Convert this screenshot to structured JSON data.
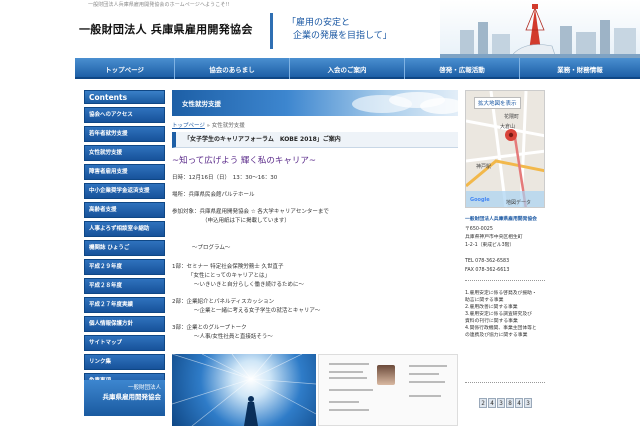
{
  "header": {
    "tagline": "一般財団法人兵庫県雇用開発協会のホームページへようこそ!!",
    "org_name": "一般財団法人 兵庫県雇用開発協会",
    "slogan_line1": "「雇用の安定と",
    "slogan_line2": "企業の発展を目指して」"
  },
  "topnav": {
    "items": [
      "トップページ",
      "協会のあらまし",
      "入会のご案内",
      "啓発・広報活動",
      "業務・財務情報"
    ]
  },
  "sidebar": {
    "heading": "Contents",
    "items": [
      "協会へのアクセス",
      "若年者就労支援",
      "女性就労支援",
      "障害者雇用支援",
      "中小企業奨学金返済支援",
      "高齢者支援",
      "人事よろず相談室※縮助",
      "機関誌 ひょうご",
      "平成２９年度",
      "平成２８年度",
      "平成２７年度実績",
      "個人情報保護方針",
      "サイトマップ",
      "リンク集",
      "免責事項"
    ],
    "footer_line1": "一般財団法人",
    "footer_line2": "兵庫県雇用開発協会"
  },
  "main": {
    "banner_title": "女性就労支援",
    "breadcrumb_home": "トップページ",
    "breadcrumb_sep": "»",
    "breadcrumb_current": "女性就労支援",
    "article_title": "「女子学生のキャリアフォーラム　KOBE 2018」ご案内",
    "subtitle": "~知って広げよう 輝く私のキャリア~",
    "date": "日時：12月16日（日）　13：30～16：30",
    "venue": "場所：兵庫県民会館パルテホール",
    "participants_1": "参加対象：兵庫県雇用開発協会 ☆ 各大学キャリアセンターまで",
    "participants_2": "（申込用紙は下に掲載しています）",
    "program": "～プログラム～",
    "part1_1": "1部：セミナー 特定社会保険労務士 久世直子",
    "part1_2": "「女性にとってのキャリアとは」",
    "part1_3": "～いきいきと自分らしく働き続けるために～",
    "part2_1": "2部：企業紹介とパネルディスカッション",
    "part2_2": "～企業と一緒に考える女子学生の就活とキャリア～",
    "part3_1": "3部：企業とのグループトーク",
    "part3_2": "～人事/女性社員と直接話そう～"
  },
  "right": {
    "map_button": "拡大地図を表示",
    "map_labels": [
      "花隈町",
      "大倉山",
      "神戸駅",
      "Google",
      "地図データ"
    ],
    "org": "一般財団法人兵庫県雇用開発協会",
    "postal": "〒650-0025",
    "address_1": "兵庫県神戸市中央区相生町",
    "address_2": "1-2-1（東成ビル3階）",
    "tel": "TEL 078-362-6583",
    "fax": "FAX 078-362-6613",
    "services": [
      "1.雇用安定に係る啓発及び援助・",
      "  助言に関する事業",
      "2.雇用改善に関する事業",
      "3.雇用安定に係る調査研究及び",
      "  資料の刊行に関する事業",
      "4.関係行政機関、事業主団体等と",
      "  の連携及び協力に関する事業"
    ],
    "counter": [
      "2",
      "4",
      "3",
      "8",
      "4",
      "3"
    ]
  }
}
